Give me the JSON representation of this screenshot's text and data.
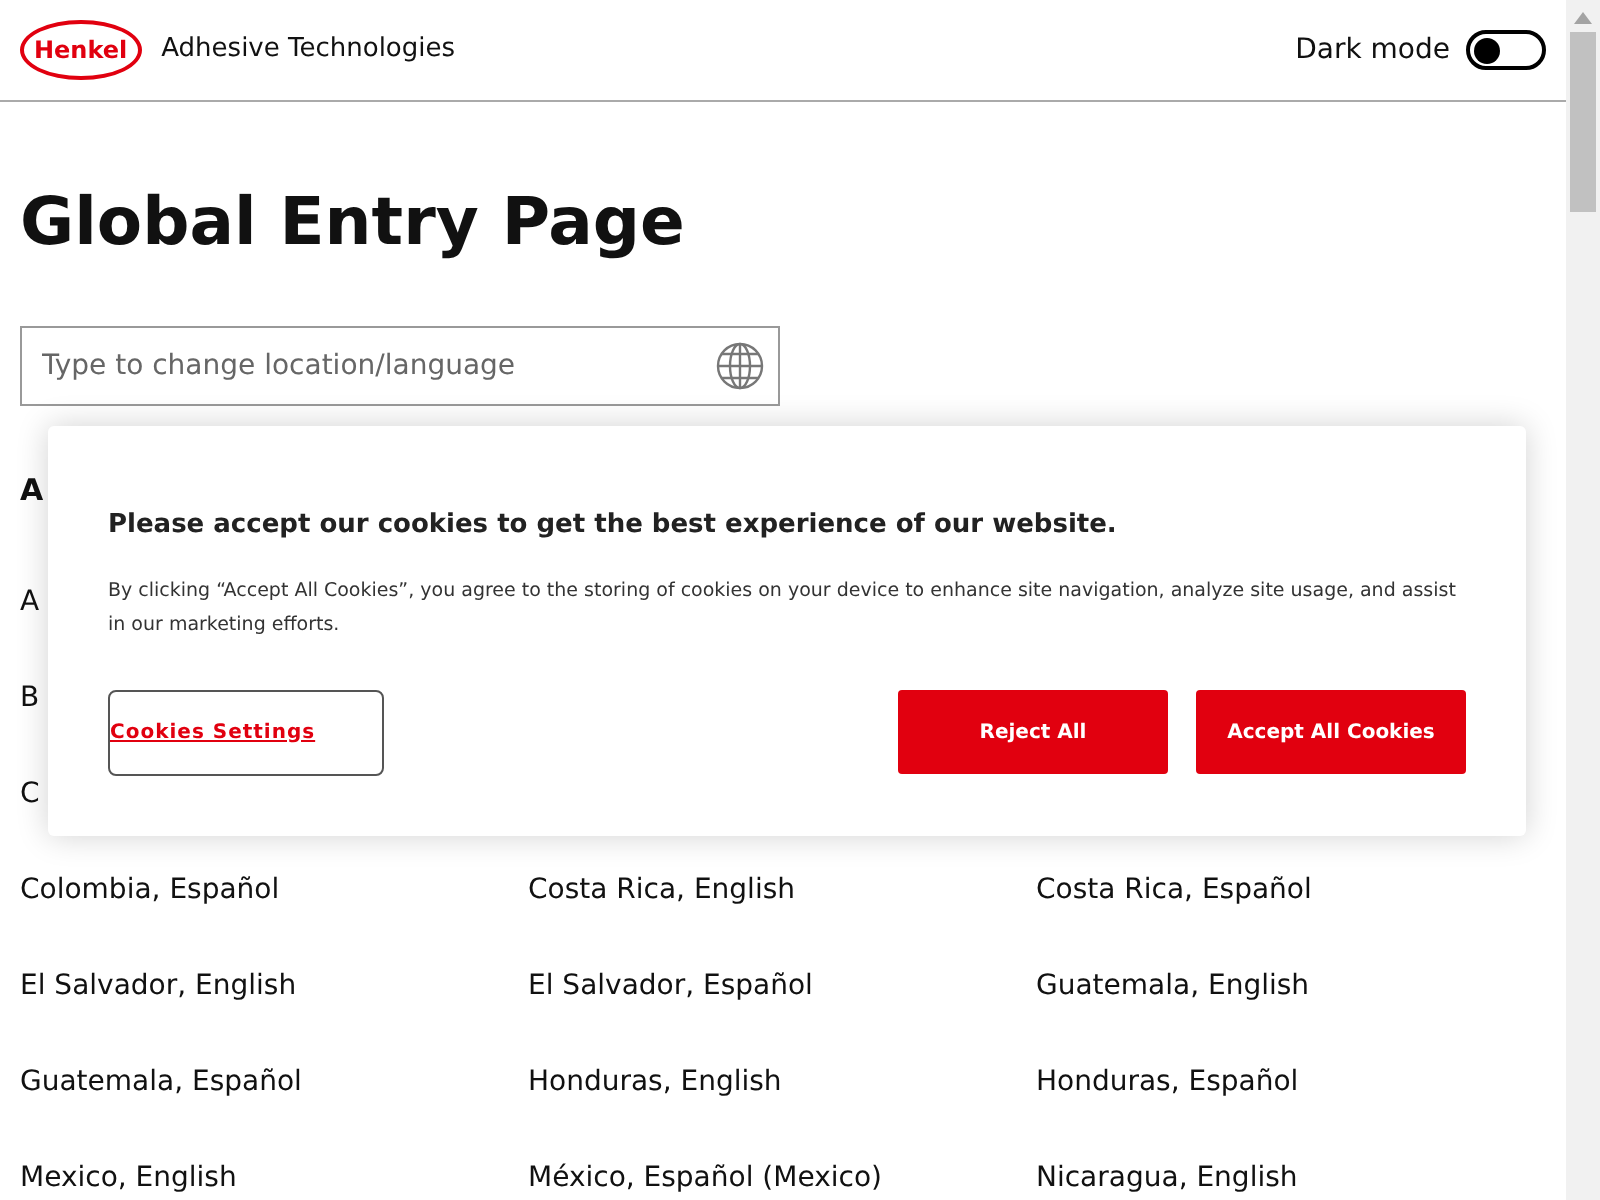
{
  "header": {
    "logo": "Henkel",
    "brand": "Adhesive Technologies",
    "dark_mode": {
      "label": "Dark mode",
      "on": false
    }
  },
  "page": {
    "title": "Global Entry Page",
    "search": {
      "placeholder": "Type to change location/language"
    }
  },
  "section_heading": "A",
  "covered_rows": [
    "A",
    "B",
    "C"
  ],
  "rows": [
    [
      "Colombia, Español",
      "Costa Rica, English",
      "Costa Rica, Español"
    ],
    [
      "El Salvador, English",
      "El Salvador, Español",
      "Guatemala, English"
    ],
    [
      "Guatemala, Español",
      "Honduras, English",
      "Honduras, Español"
    ],
    [
      "Mexico, English",
      "México, Español (Mexico)",
      "Nicaragua, English"
    ]
  ],
  "cookie_banner": {
    "title": "Please accept our cookies to get the best experience of our website.",
    "text": "By clicking “Accept All Cookies”, you agree to the storing of cookies on your device to enhance site navigation, analyze site usage, and assist in our marketing efforts.",
    "settings_link": "Cookies Settings",
    "reject": "Reject All",
    "accept": "Accept All Cookies"
  }
}
